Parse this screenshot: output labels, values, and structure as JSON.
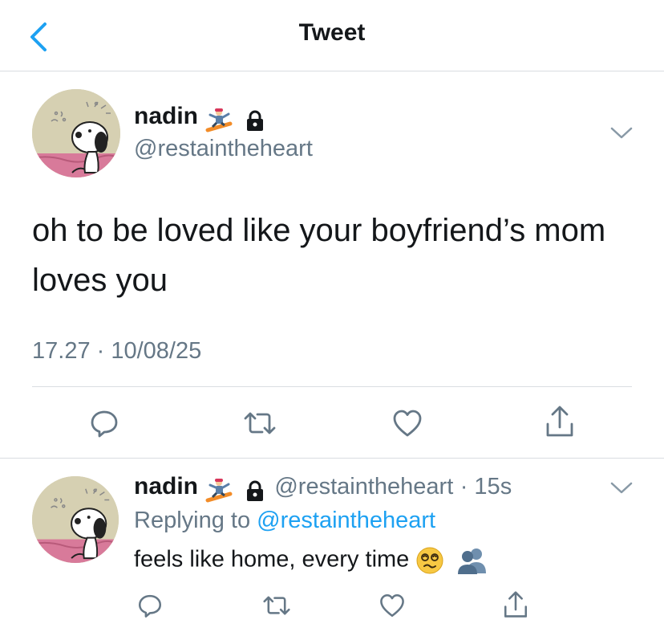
{
  "header": {
    "title": "Tweet"
  },
  "main_tweet": {
    "display_name": "nadin",
    "handle": "@restaintheheart",
    "text": "oh to be loved like your boyfriend’s mom loves you",
    "timestamp": "17.27 · 10/08/25",
    "icons": [
      "snowboarder-emoji-icon",
      "lock-icon",
      "chevron-down-icon",
      "reply-icon",
      "retweet-icon",
      "like-icon",
      "share-icon"
    ]
  },
  "reply_tweet": {
    "display_name": "nadin",
    "handle": "@restaintheheart",
    "time_ago": "· 15s",
    "replying_prefix": "Replying to",
    "replying_handle": "@restaintheheart",
    "text": "feels like home, every time",
    "icons": [
      "snowboarder-emoji-icon",
      "lock-icon",
      "dizzy-face-emoji-icon",
      "busts-emoji-icon",
      "chevron-down-icon",
      "reply-icon",
      "retweet-icon",
      "like-icon",
      "share-icon"
    ]
  },
  "colors": {
    "text": "#14171a",
    "secondary": "#657786",
    "accent": "#1da1f2",
    "divider": "#d9dde1"
  }
}
